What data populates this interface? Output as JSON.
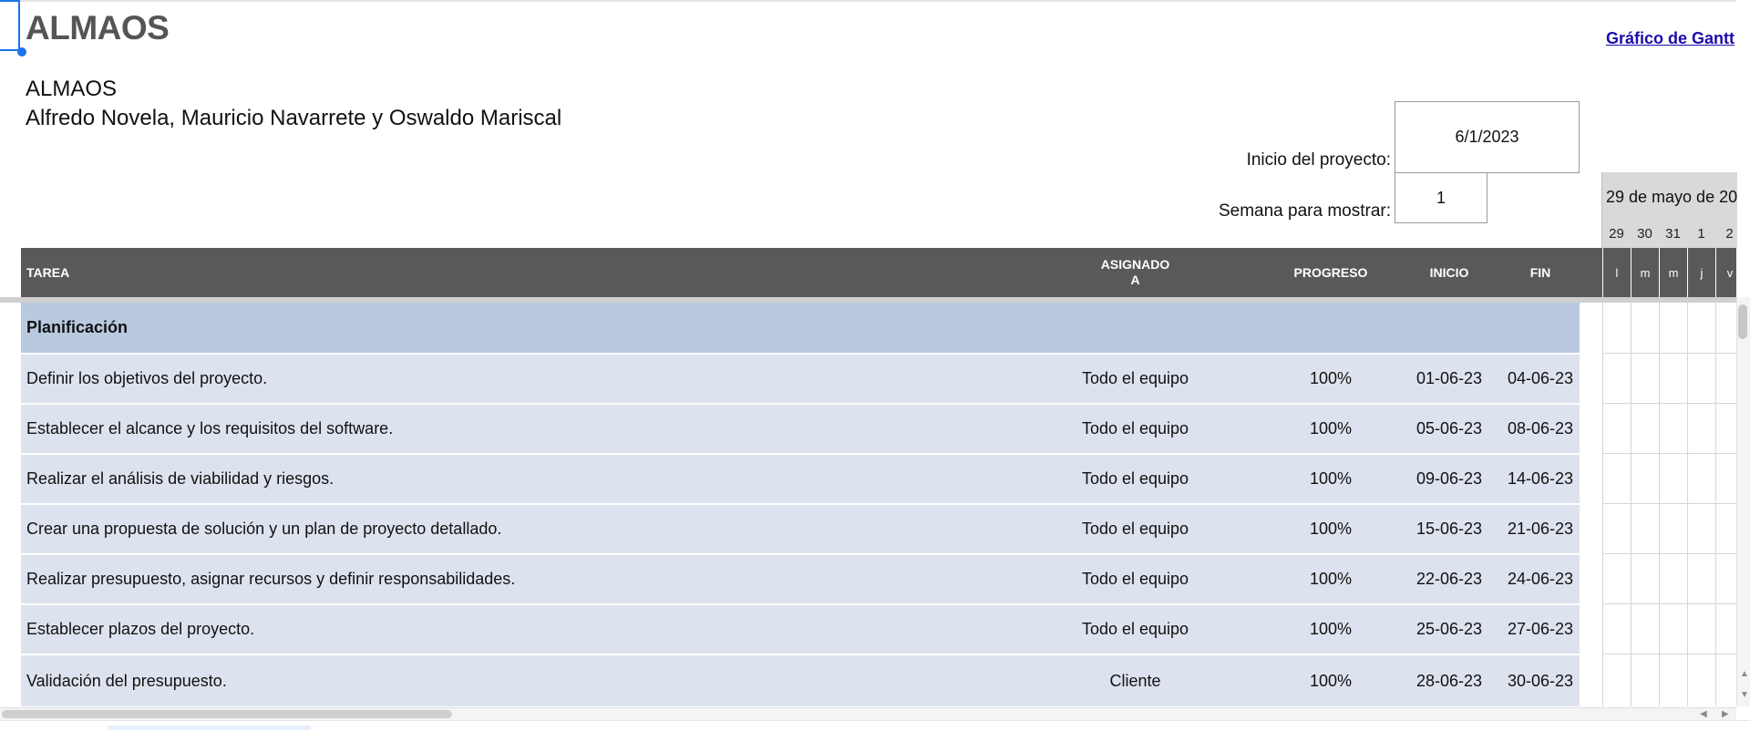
{
  "sheet": {
    "title": "ALMAOS",
    "gantt_link": "Gráfico de Gantt",
    "company": "ALMAOS",
    "authors": "Alfredo Novela, Mauricio Navarrete y Oswaldo Mariscal",
    "project_start_label": "Inicio del proyecto:",
    "project_start_value": "6/1/2023",
    "week_label": "Semana para mostrar:",
    "week_value": "1"
  },
  "calendar": {
    "week_title": "29 de mayo de 20",
    "days": [
      {
        "num": "29",
        "letter": "l"
      },
      {
        "num": "30",
        "letter": "m"
      },
      {
        "num": "31",
        "letter": "m"
      },
      {
        "num": "1",
        "letter": "j"
      },
      {
        "num": "2",
        "letter": "v"
      }
    ]
  },
  "columns": {
    "tarea": "TAREA",
    "asignado_1": "ASIGNADO",
    "asignado_2": "A",
    "progreso": "PROGRESO",
    "inicio": "INICIO",
    "fin": "FIN"
  },
  "phase": {
    "name": "Planificación"
  },
  "tasks": [
    {
      "name": "Definir los objetivos del proyecto.",
      "assigned": "Todo el equipo",
      "progress": "100%",
      "start": "01-06-23",
      "end": "04-06-23"
    },
    {
      "name": "Establecer el alcance y los requisitos del software.",
      "assigned": "Todo el equipo",
      "progress": "100%",
      "start": "05-06-23",
      "end": "08-06-23"
    },
    {
      "name": "Realizar el análisis de viabilidad y riesgos.",
      "assigned": "Todo el equipo",
      "progress": "100%",
      "start": "09-06-23",
      "end": "14-06-23"
    },
    {
      "name": "Crear una propuesta de solución y un  plan de proyecto detallado.",
      "assigned": "Todo el equipo",
      "progress": "100%",
      "start": "15-06-23",
      "end": "21-06-23"
    },
    {
      "name": "Realizar presupuesto, asignar recursos y definir responsabilidades.",
      "assigned": "Todo el equipo",
      "progress": "100%",
      "start": "22-06-23",
      "end": "24-06-23"
    },
    {
      "name": "Establecer plazos del proyecto.",
      "assigned": "Todo el equipo",
      "progress": "100%",
      "start": "25-06-23",
      "end": "27-06-23"
    },
    {
      "name": "Validación del presupuesto.",
      "assigned": "Cliente",
      "progress": "100%",
      "start": "28-06-23",
      "end": "30-06-23"
    }
  ],
  "colors": {
    "header_bg": "#595959",
    "phase_bg": "#b8c9e0",
    "task_bg": "#dde3ee",
    "link": "#1a0dab",
    "selection": "#1a73e8"
  }
}
